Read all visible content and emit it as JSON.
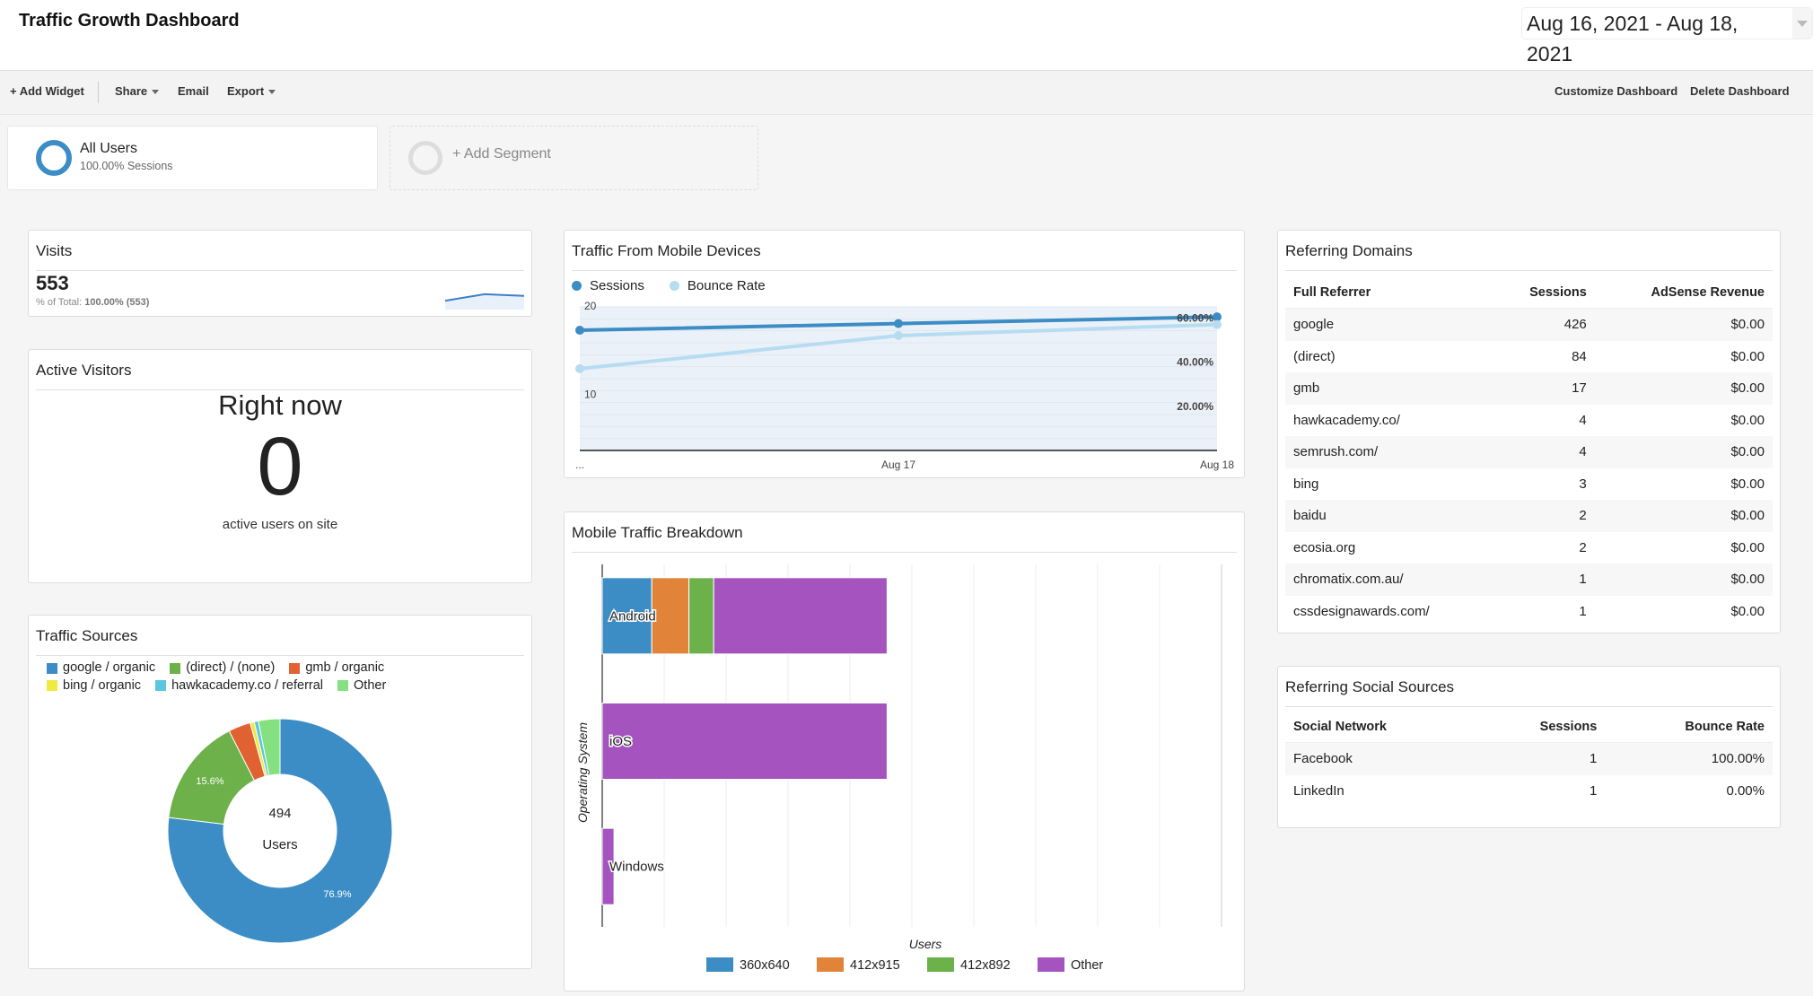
{
  "header": {
    "title": "Traffic Growth Dashboard",
    "date_range": "Aug 16, 2021 - Aug 18, 2021"
  },
  "toolbar": {
    "add_widget": "+ Add Widget",
    "share": "Share",
    "email": "Email",
    "export": "Export",
    "customize": "Customize Dashboard",
    "delete": "Delete Dashboard"
  },
  "segments": {
    "active": {
      "name": "All Users",
      "sub": "100.00% Sessions",
      "color": "#3c8dc5"
    },
    "add_label": "+ Add Segment"
  },
  "visits": {
    "title": "Visits",
    "value": "553",
    "pct_label": "% of Total:",
    "pct_value": "100.00% (553)",
    "sparkline": [
      0.55,
      0.95,
      0.85
    ]
  },
  "active_visitors": {
    "title": "Active Visitors",
    "heading": "Right now",
    "count": "0",
    "caption": "active users on site"
  },
  "colors": {
    "primary": "#3c8dc5",
    "light_blue": "#b6dcf2",
    "orange": "#e1843a",
    "green": "#6db14a",
    "purple": "#a553be"
  },
  "chart_data": [
    {
      "type": "pie",
      "title": "Traffic Sources",
      "center_value": "494",
      "center_label": "Users",
      "legend_position": "top",
      "slices": [
        {
          "label": "google / organic",
          "value": 76.9,
          "color": "#3c8dc5",
          "show_label": "76.9%"
        },
        {
          "label": "(direct) / (none)",
          "value": 15.6,
          "color": "#6db14a",
          "show_label": "15.6%"
        },
        {
          "label": "gmb / organic",
          "value": 3.2,
          "color": "#e06132",
          "show_label": ""
        },
        {
          "label": "bing / organic",
          "value": 0.6,
          "color": "#eeea3f",
          "show_label": ""
        },
        {
          "label": "hawkacademy.co / referral",
          "value": 0.6,
          "color": "#5ac6e0",
          "show_label": ""
        },
        {
          "label": "Other",
          "value": 3.1,
          "color": "#85e07f",
          "show_label": ""
        }
      ]
    },
    {
      "type": "line",
      "title": "Traffic From Mobile Devices",
      "x": [
        "...",
        "Aug 17",
        "Aug 18"
      ],
      "series": [
        {
          "name": "Sessions",
          "axis": "left",
          "values": [
            18,
            19,
            20
          ],
          "color": "#3c8dc5"
        },
        {
          "name": "Bounce Rate",
          "axis": "right",
          "values": [
            37,
            52,
            57
          ],
          "color": "#b6dcf2"
        }
      ],
      "left_ticks": [
        "20",
        "10"
      ],
      "right_ticks": [
        "60.00%",
        "40.00%",
        "20.00%"
      ],
      "left_ylim": [
        0,
        21.5
      ],
      "right_ylim": [
        0,
        65
      ],
      "legend_position": "top-left",
      "grid": true
    },
    {
      "type": "bar",
      "orientation": "horizontal",
      "stacked": true,
      "title": "Mobile Traffic Breakdown",
      "xlabel": "Users",
      "ylabel": "Operating System",
      "categories": [
        "Android",
        "iOS",
        "Windows"
      ],
      "xlim_gridlines": 10,
      "series": [
        {
          "name": "360x640",
          "color": "#3c8dc5",
          "values": [
            0.8,
            0,
            0
          ]
        },
        {
          "name": "412x915",
          "color": "#e1843a",
          "values": [
            0.6,
            0,
            0
          ]
        },
        {
          "name": "412x892",
          "color": "#6db14a",
          "values": [
            0.4,
            0,
            0
          ]
        },
        {
          "name": "Other",
          "color": "#a553be",
          "values": [
            2.8,
            4.6,
            0.19
          ]
        }
      ],
      "legend_position": "bottom"
    }
  ],
  "referring_domains": {
    "title": "Referring Domains",
    "columns": [
      "Full Referrer",
      "Sessions",
      "AdSense Revenue"
    ],
    "rows": [
      [
        "google",
        "426",
        "$0.00"
      ],
      [
        "(direct)",
        "84",
        "$0.00"
      ],
      [
        "gmb",
        "17",
        "$0.00"
      ],
      [
        "hawkacademy.co/",
        "4",
        "$0.00"
      ],
      [
        "semrush.com/",
        "4",
        "$0.00"
      ],
      [
        "bing",
        "3",
        "$0.00"
      ],
      [
        "baidu",
        "2",
        "$0.00"
      ],
      [
        "ecosia.org",
        "2",
        "$0.00"
      ],
      [
        "chromatix.com.au/",
        "1",
        "$0.00"
      ],
      [
        "cssdesignawards.com/",
        "1",
        "$0.00"
      ]
    ]
  },
  "social_sources": {
    "title": "Referring Social Sources",
    "columns": [
      "Social Network",
      "Sessions",
      "Bounce Rate"
    ],
    "rows": [
      [
        "Facebook",
        "1",
        "100.00%"
      ],
      [
        "LinkedIn",
        "1",
        "0.00%"
      ]
    ]
  }
}
